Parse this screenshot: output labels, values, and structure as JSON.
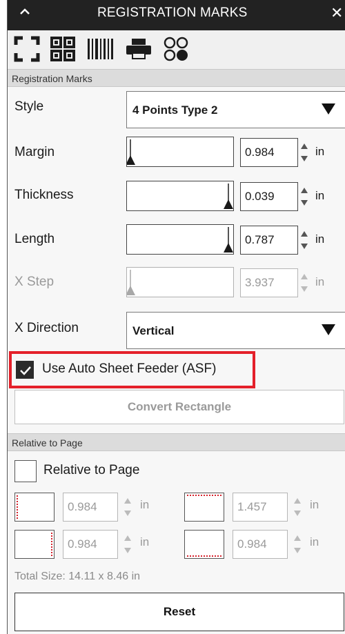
{
  "titlebar": {
    "title": "REGISTRATION MARKS",
    "collapse_icon": "chevron-up-icon",
    "close_icon": "close-icon"
  },
  "toolbar": {
    "icons": [
      "corner-marks-icon",
      "grid-marks-icon",
      "barcode-icon",
      "printer-icon",
      "dots-icon"
    ]
  },
  "registration_marks": {
    "header": "Registration Marks",
    "style": {
      "label": "Style",
      "value": "4 Points Type 2"
    },
    "margin": {
      "label": "Margin",
      "value": "0.984",
      "unit": "in",
      "level": 0.0
    },
    "thickness": {
      "label": "Thickness",
      "value": "0.039",
      "unit": "in",
      "level": 1.0
    },
    "length": {
      "label": "Length",
      "value": "0.787",
      "unit": "in",
      "level": 1.0
    },
    "x_step": {
      "label": "X Step",
      "value": "3.937",
      "unit": "in",
      "level": 0.0,
      "disabled": true
    },
    "x_direction": {
      "label": "X Direction",
      "value": "Vertical"
    },
    "asf": {
      "label": "Use Auto Sheet Feeder (ASF)",
      "checked": true
    },
    "convert_button": "Convert Rectangle"
  },
  "relative_to_page": {
    "header": "Relative to Page",
    "checkbox_label": "Relative to Page",
    "checked": false,
    "left": {
      "value": "0.984",
      "unit": "in"
    },
    "top": {
      "value": "1.457",
      "unit": "in"
    },
    "right": {
      "value": "0.984",
      "unit": "in"
    },
    "bottom": {
      "value": "0.984",
      "unit": "in"
    },
    "total_size": "Total Size: 14.11 x 8.46 in",
    "reset_button": "Reset"
  },
  "colors": {
    "titlebar": "#222222",
    "highlight": "#e4202a",
    "disabled": "#9a9a9a"
  }
}
